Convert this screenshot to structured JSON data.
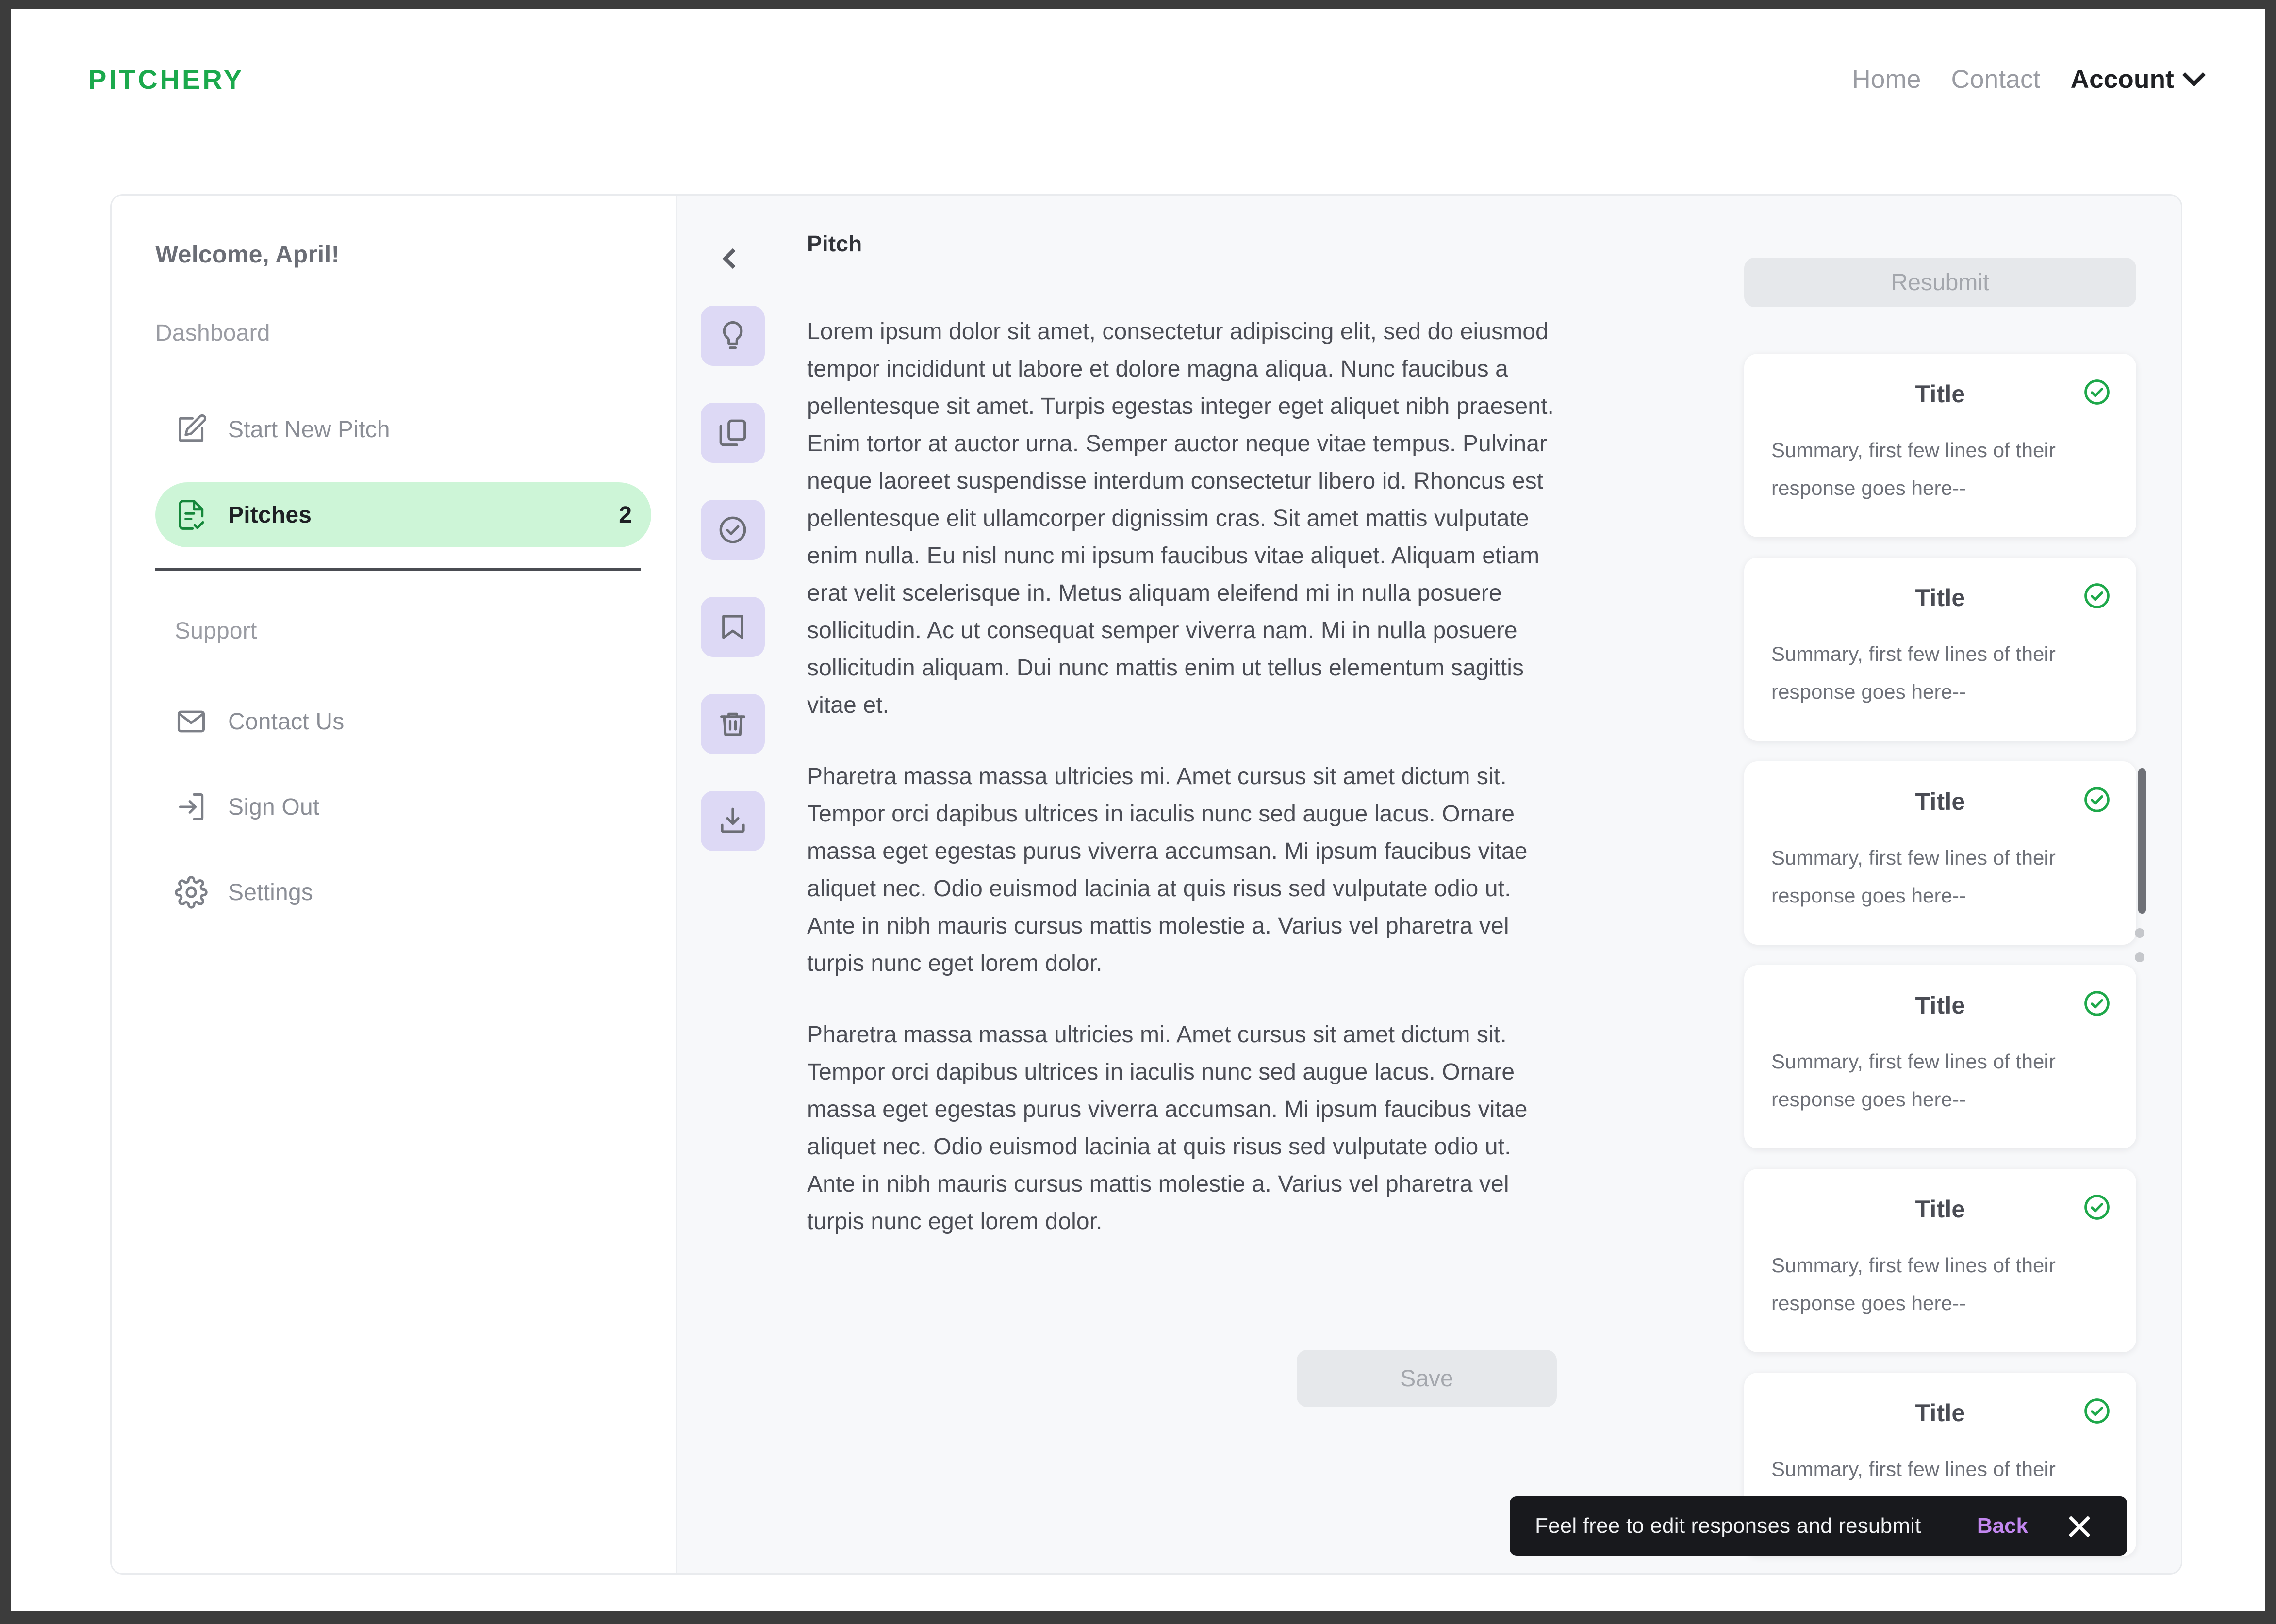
{
  "app": {
    "logo": "PITCHERY"
  },
  "topnav": {
    "links": [
      {
        "label": "Home",
        "name": "nav-home"
      },
      {
        "label": "Contact",
        "name": "nav-contact"
      }
    ],
    "account": {
      "label": "Account",
      "icon": "chevron-down-icon"
    }
  },
  "sidebar": {
    "welcome": "Welcome, April!",
    "dashboard_label": "Dashboard",
    "items": [
      {
        "label": "Start New Pitch",
        "icon": "pencil-square-icon",
        "active": false,
        "count": ""
      },
      {
        "label": "Pitches",
        "icon": "document-check-icon",
        "active": true,
        "count": "2"
      }
    ],
    "support_label": "Support",
    "support_items": [
      {
        "label": "Contact Us",
        "icon": "envelope-icon"
      },
      {
        "label": "Sign Out",
        "icon": "sign-out-icon"
      },
      {
        "label": "Settings",
        "icon": "gear-icon"
      }
    ]
  },
  "rail": {
    "collapse_icon": "chevron-left-icon",
    "buttons": [
      {
        "icon": "lightbulb-icon"
      },
      {
        "icon": "copy-icon"
      },
      {
        "icon": "check-circle-icon"
      },
      {
        "icon": "bookmark-icon"
      },
      {
        "icon": "trash-icon"
      },
      {
        "icon": "download-icon"
      }
    ]
  },
  "pitch": {
    "label": "Pitch",
    "paragraphs": [
      "Lorem ipsum dolor sit amet, consectetur adipiscing elit, sed do eiusmod tempor incididunt ut labore et dolore magna aliqua. Nunc faucibus a pellentesque sit amet. Turpis egestas integer eget aliquet nibh praesent. Enim tortor at auctor urna. Semper auctor neque vitae tempus. Pulvinar neque laoreet suspendisse interdum consectetur libero id. Rhoncus est pellentesque elit ullamcorper dignissim cras. Sit amet mattis vulputate enim nulla. Eu nisl nunc mi ipsum faucibus vitae aliquet. Aliquam etiam erat velit scelerisque in. Metus aliquam eleifend mi in nulla posuere sollicitudin. Ac ut consequat semper viverra nam. Mi in nulla posuere sollicitudin aliquam. Dui nunc mattis enim ut tellus elementum sagittis vitae et.",
      "Pharetra massa massa ultricies mi. Amet cursus sit amet dictum sit. Tempor orci dapibus ultrices in iaculis nunc sed augue lacus. Ornare massa eget egestas purus viverra accumsan. Mi ipsum faucibus vitae aliquet nec. Odio euismod lacinia at quis risus sed vulputate odio ut. Ante in nibh mauris cursus mattis molestie a. Varius vel pharetra vel turpis nunc eget lorem dolor.",
      "Pharetra massa massa ultricies mi. Amet cursus sit amet dictum sit. Tempor orci dapibus ultrices in iaculis nunc sed augue lacus. Ornare massa eget egestas purus viverra accumsan. Mi ipsum faucibus vitae aliquet nec. Odio euismod lacinia at quis risus sed vulputate odio ut. Ante in nibh mauris cursus mattis molestie a. Varius vel pharetra vel turpis nunc eget lorem dolor."
    ],
    "save_label": "Save"
  },
  "cards_panel": {
    "resubmit_label": "Resubmit",
    "cards": [
      {
        "title": "Title",
        "summary": "Summary, first few lines of their response goes here--",
        "status_icon": "check-circle-icon"
      },
      {
        "title": "Title",
        "summary": "Summary, first few lines of their response goes here--",
        "status_icon": "check-circle-icon"
      },
      {
        "title": "Title",
        "summary": "Summary, first few lines of their response goes here--",
        "status_icon": "check-circle-icon"
      },
      {
        "title": "Title",
        "summary": "Summary, first few lines of their response goes here--",
        "status_icon": "check-circle-icon"
      },
      {
        "title": "Title",
        "summary": "Summary, first few lines of their response goes here--",
        "status_icon": "check-circle-icon"
      },
      {
        "title": "Title",
        "summary": "Summary, first few lines of their response goes here--",
        "status_icon": "check-circle-icon"
      }
    ]
  },
  "toast": {
    "message": "Feel free to edit responses and resubmit",
    "action_label": "Back",
    "close_icon": "close-icon"
  },
  "colors": {
    "brand_green": "#1ba94c",
    "active_pill": "#cdf5d7",
    "rail_button": "#ddd9f5",
    "status_green": "#1ea84a",
    "toast_bg": "#18191d",
    "toast_action": "#c387f0"
  }
}
